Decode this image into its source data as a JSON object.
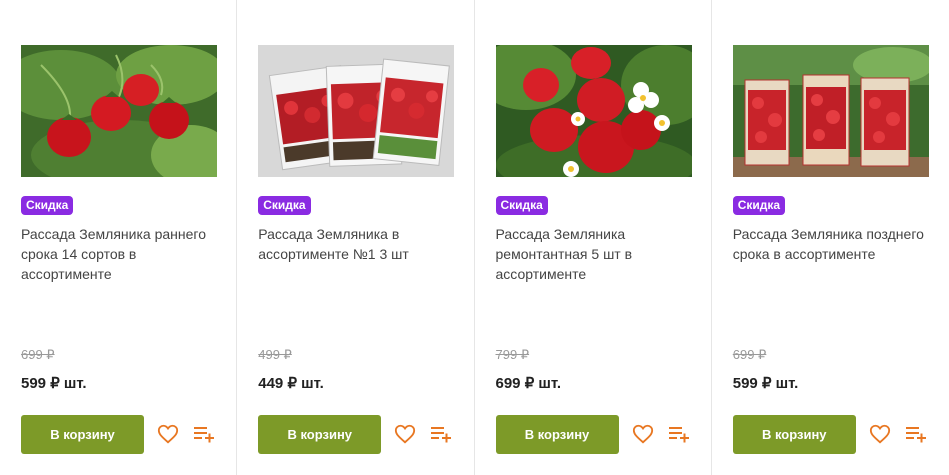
{
  "products": [
    {
      "badge": "Скидка",
      "title": "Рассада Земляника раннего срока 14 сортов в ассортименте",
      "old_price": "699 ₽",
      "price": "599 ₽ шт.",
      "cart_label": "В корзину",
      "image": "strawberries-on-leaves-photo"
    },
    {
      "badge": "Скидка",
      "title": "Рассада Земляника в ассортименте №1 3 шт",
      "old_price": "499 ₽",
      "price": "449 ₽ шт.",
      "cart_label": "В корзину",
      "image": "seedling-packets-photo"
    },
    {
      "badge": "Скидка",
      "title": "Рассада Земляника ремонтантная 5 шт в ассортименте",
      "old_price": "799 ₽",
      "price": "699 ₽ шт.",
      "cart_label": "В корзину",
      "image": "strawberries-with-flowers-photo"
    },
    {
      "badge": "Скидка",
      "title": "Рассада Земляника позднего срока в ассортименте",
      "old_price": "699 ₽",
      "price": "599 ₽ шт.",
      "cart_label": "В корзину",
      "image": "seedling-boxes-photo"
    }
  ],
  "colors": {
    "badge": "#8a2be2",
    "cart_button": "#7d9a28",
    "icon_accent": "#e87722"
  }
}
